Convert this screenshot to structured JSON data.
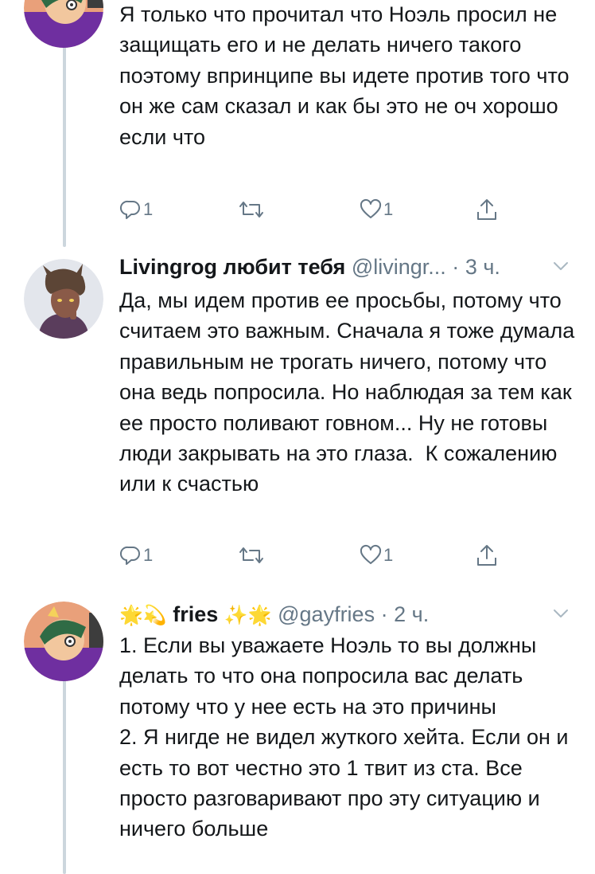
{
  "tweets": [
    {
      "text": "Я только что прочитал что Ноэль просил не защищать его и не делать ничего такого поэтому впринципе вы идете против того что он же сам сказал и как бы это не оч хорошо если что",
      "actions": {
        "reply_count": "1",
        "retweet_count": "",
        "like_count": "1"
      }
    },
    {
      "name": "Livingrog любит тебя",
      "handle": "@livingr...",
      "dot": "·",
      "time": "3 ч.",
      "text": "Да, мы идем против ее просьбы, потому что считаем это важным. Сначала я тоже думала правильным не трогать ничего, потому что она ведь попросила. Но наблюдая за тем как ее просто поливают говном... Ну не готовы люди закрывать на это глаза.  К сожалению или к счастью",
      "actions": {
        "reply_count": "1",
        "retweet_count": "",
        "like_count": "1"
      }
    },
    {
      "name_prefix_emoji": "🌟💫",
      "name": "fries",
      "name_suffix_emoji": "✨🌟",
      "handle": "@gayfries",
      "dot": "·",
      "time": "2 ч.",
      "text": "1. Если вы уважаете Ноэль то вы должны делать то что она попросила вас делать потому что у нее есть на это причины\n2. Я нигде не видел жуткого хейта. Если он и есть то вот честно это 1 твит из ста. Все просто разговаривают про эту ситуацию и ничего больше"
    }
  ],
  "colors": {
    "text": "#14171a",
    "secondary": "#657786",
    "thread_line": "#ccd6dd"
  },
  "icons": [
    "reply-icon",
    "retweet-icon",
    "like-icon",
    "share-icon",
    "chevron-down-icon"
  ]
}
